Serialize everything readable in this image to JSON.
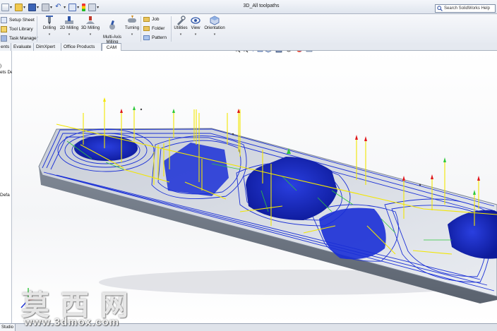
{
  "window": {
    "title": "3D_All toolpaths"
  },
  "search": {
    "placeholder": "Search SolidWorks Help"
  },
  "quick_access": {
    "icons": [
      "new-document-icon",
      "open-folder-icon",
      "save-icon",
      "print-icon",
      "undo-icon",
      "select-icon",
      "rebuild-icon",
      "options-icon"
    ]
  },
  "ribbon": {
    "side_items": [
      "Setup Sheet",
      "Tool Library",
      "Task Manager"
    ],
    "buttons": [
      {
        "label": "Drilling"
      },
      {
        "label": "2D Milling"
      },
      {
        "label": "3D Milling"
      },
      {
        "label": "Multi-Axis\nMilling"
      },
      {
        "label": "Turning"
      }
    ],
    "folder_items": [
      "Job",
      "Folder",
      "Pattern"
    ],
    "right_buttons": [
      {
        "label": "Utilities"
      },
      {
        "label": "View"
      },
      {
        "label": "Orientation"
      }
    ]
  },
  "tabs": [
    "ents",
    "Evaluate",
    "DimXpert",
    "Office Products",
    "CAM"
  ],
  "active_tab": "CAM",
  "left_panel": {
    "line1": ")",
    "line2": "ets De",
    "line3": "Defa"
  },
  "status": {
    "studio_tab": "Studio"
  },
  "watermark": {
    "chinese": "莫西网",
    "url": "www.3dmox.com"
  },
  "colors": {
    "toolpath_blue": "#1a2fd6",
    "stock_gray": "#8d96a3",
    "drill_yellow": "#f2e600",
    "accent_green": "#2fc83a",
    "accent_red": "#e0171c"
  }
}
